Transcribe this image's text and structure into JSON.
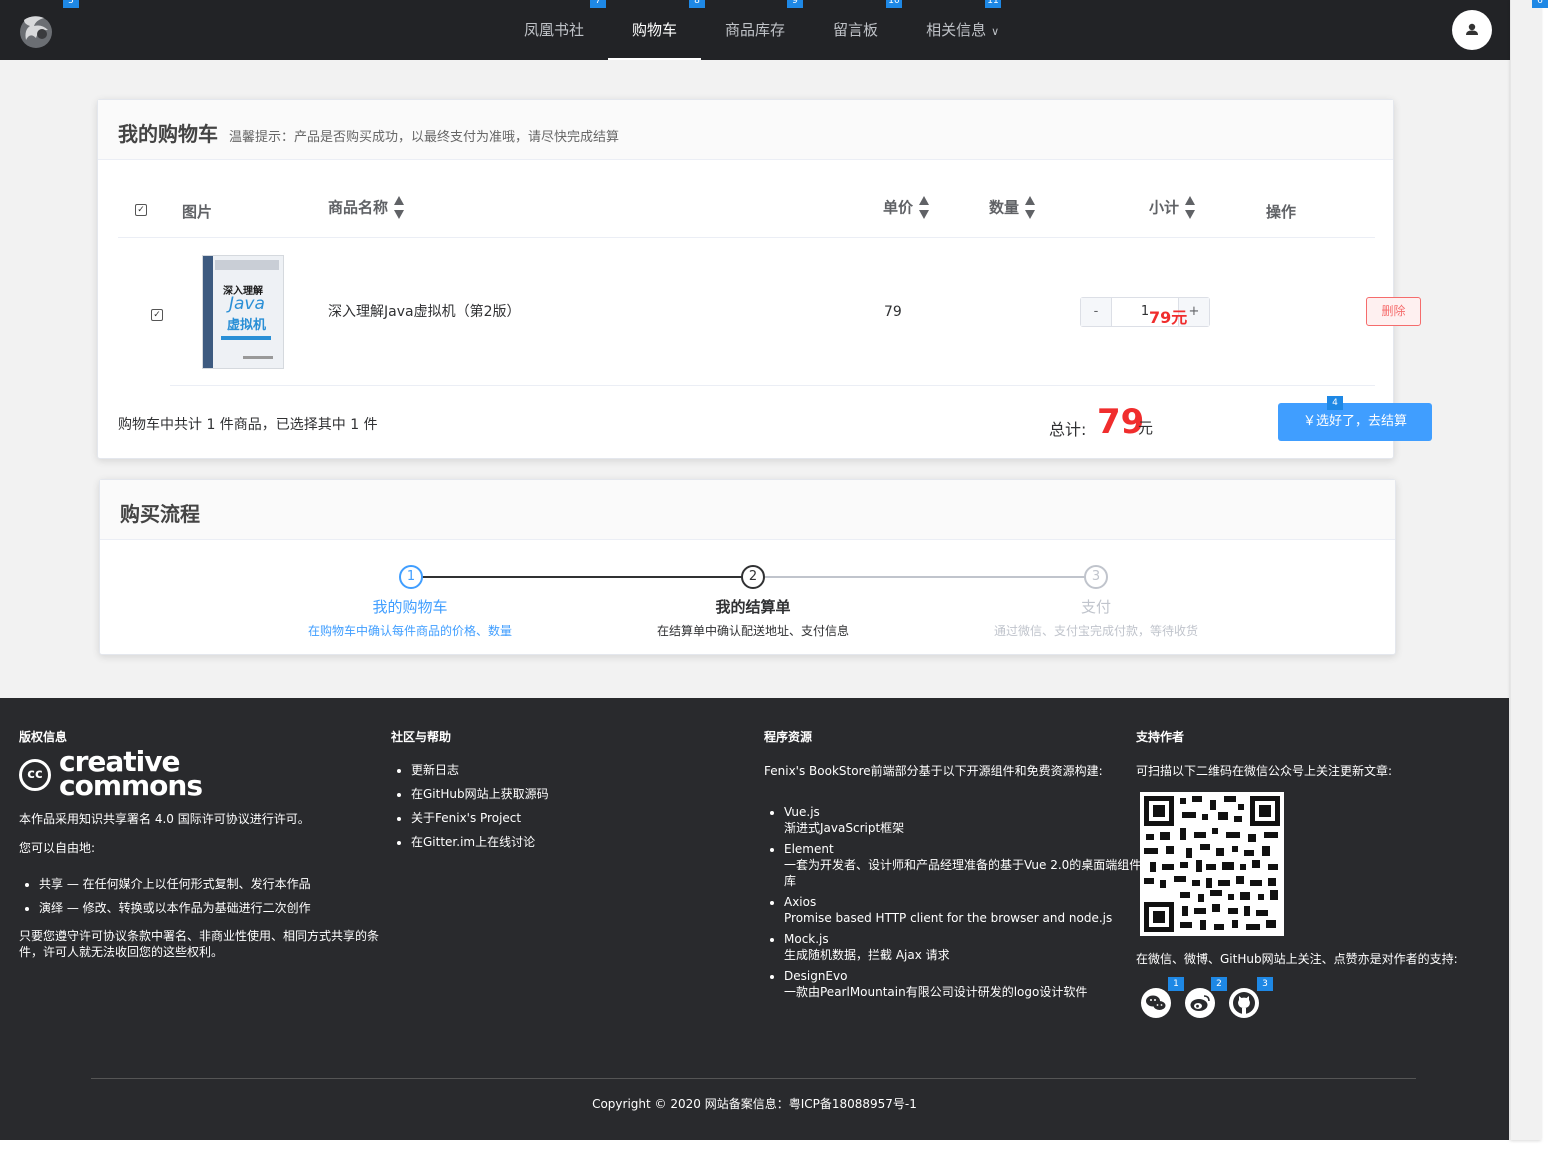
{
  "header": {
    "nav": [
      {
        "label": "凤凰书社",
        "badge": "7"
      },
      {
        "label": "购物车",
        "badge": "8",
        "active": true
      },
      {
        "label": "商品库存",
        "badge": "9"
      },
      {
        "label": "留言板",
        "badge": "10"
      },
      {
        "label": "相关信息",
        "badge": "11",
        "has_dropdown": true
      }
    ],
    "nav_badges": [
      "7",
      "8",
      "9",
      "10",
      "11"
    ],
    "logo_badge": "5",
    "scroll_badge": "6",
    "chevron": "∨"
  },
  "cart": {
    "title": "我的购物车",
    "hint": "温馨提示：产品是否购买成功，以最终支付为准哦，请尽快完成结算",
    "columns": {
      "image": "图片",
      "name": "商品名称",
      "price": "单价",
      "quantity": "数量",
      "subtotal": "小计",
      "action": "操作"
    },
    "items": [
      {
        "name": "深入理解Java虚拟机（第2版）",
        "price": "79",
        "quantity": "1",
        "subtotal": "79元",
        "cover_text": [
          "深入理解",
          "Java",
          "虚拟机"
        ]
      }
    ],
    "stepper_minus": "-",
    "stepper_plus": "+",
    "delete_label": "删除",
    "summary": "购物车中共计 1 件商品，已选择其中 1 件",
    "total_label": "总计:",
    "total_value": "79",
    "total_unit": "元",
    "checkout_label": "￥选好了，去结算",
    "checkout_badge": "4"
  },
  "process": {
    "title": "购买流程",
    "steps": [
      {
        "num": "1",
        "title": "我的购物车",
        "desc": "在购物车中确认每件商品的价格、数量",
        "state": "done"
      },
      {
        "num": "2",
        "title": "我的结算单",
        "desc": "在结算单中确认配送地址、支付信息",
        "state": "current"
      },
      {
        "num": "3",
        "title": "支付",
        "desc": "通过微信、支付宝完成付款，等待收货",
        "state": "wait"
      }
    ]
  },
  "footer": {
    "copyright": {
      "title": "版权信息",
      "cc_line1": "creative",
      "cc_line2": "commons",
      "cc_mark": "cc",
      "license": "本作品采用知识共享署名 4.0 国际许可协议进行许可。",
      "free_to": "您可以自由地:",
      "rights": [
        "共享 — 在任何媒介上以任何形式复制、发行本作品",
        "演绎 — 修改、转换或以本作品为基础进行二次创作"
      ],
      "condition": "只要您遵守许可协议条款中署名、非商业性使用、相同方式共享的条件，许可人就无法收回您的这些权利。"
    },
    "community": {
      "title": "社区与帮助",
      "links": [
        "更新日志",
        "在GitHub网站上获取源码",
        "关于Fenix's Project",
        "在Gitter.im上在线讨论"
      ]
    },
    "resources": {
      "title": "程序资源",
      "intro": "Fenix's BookStore前端部分基于以下开源组件和免费资源构建:",
      "items": [
        {
          "name": "Vue.js",
          "desc": "渐进式JavaScript框架"
        },
        {
          "name": "Element",
          "desc": "一套为开发者、设计师和产品经理准备的基于Vue 2.0的桌面端组件库"
        },
        {
          "name": "Axios",
          "desc": "Promise based HTTP client for the browser and node.js"
        },
        {
          "name": "Mock.js",
          "desc": "生成随机数据，拦截 Ajax 请求"
        },
        {
          "name": "DesignEvo",
          "desc": "一款由PearlMountain有限公司设计研发的logo设计软件"
        }
      ]
    },
    "support": {
      "title": "支持作者",
      "qr_text": "可扫描以下二维码在微信公众号上关注更新文章:",
      "follow_text": "在微信、微博、GitHub网站上关注、点赞亦是对作者的支持:",
      "social_badges": [
        "1",
        "2",
        "3"
      ]
    },
    "bottom": "Copyright © 2020 网站备案信息：粤ICP备18088957号-1"
  },
  "colors": {
    "accent": "#409eff",
    "danger": "#f56c6c",
    "price_red": "#f02d2d",
    "header_bg": "#222326",
    "footer_bg": "#292a2d"
  }
}
